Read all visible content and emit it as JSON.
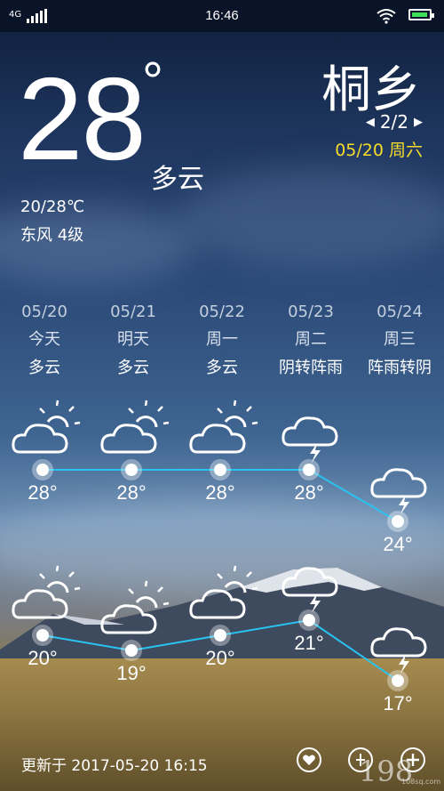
{
  "status_bar": {
    "network": "4G",
    "time": "16:46"
  },
  "current": {
    "temperature": "28",
    "degree_symbol": "°",
    "condition": "多云",
    "range": "20/28℃",
    "wind": "东风 4级"
  },
  "location": {
    "city": "桐乡",
    "page": "2/2",
    "date": "05/20 周六"
  },
  "forecast": [
    {
      "date": "05/20",
      "day": "今天",
      "condition": "多云",
      "high": "28°",
      "low": "20°",
      "high_icon": "partly-cloudy",
      "low_icon": "partly-cloudy"
    },
    {
      "date": "05/21",
      "day": "明天",
      "condition": "多云",
      "high": "28°",
      "low": "19°",
      "high_icon": "partly-cloudy",
      "low_icon": "partly-cloudy"
    },
    {
      "date": "05/22",
      "day": "周一",
      "condition": "多云",
      "high": "28°",
      "low": "20°",
      "high_icon": "partly-cloudy",
      "low_icon": "partly-cloudy"
    },
    {
      "date": "05/23",
      "day": "周二",
      "condition": "阴转阵雨",
      "high": "28°",
      "low": "21°",
      "high_icon": "thunder-cloud",
      "low_icon": "thunder-cloud"
    },
    {
      "date": "05/24",
      "day": "周三",
      "condition": "阵雨转阴",
      "high": "24°",
      "low": "17°",
      "high_icon": "thunder-cloud",
      "low_icon": "thunder-cloud"
    }
  ],
  "chart_data": {
    "type": "line",
    "categories": [
      "05/20",
      "05/21",
      "05/22",
      "05/23",
      "05/24"
    ],
    "series": [
      {
        "values": [
          28,
          28,
          28,
          28,
          24
        ]
      },
      {
        "values": [
          20,
          19,
          20,
          21,
          17
        ]
      }
    ],
    "line_color": "#29c3f0"
  },
  "footer": {
    "updated": "更新于 2017-05-20 16:15",
    "watermark": "198",
    "watermark_sub": "108sq.com"
  }
}
